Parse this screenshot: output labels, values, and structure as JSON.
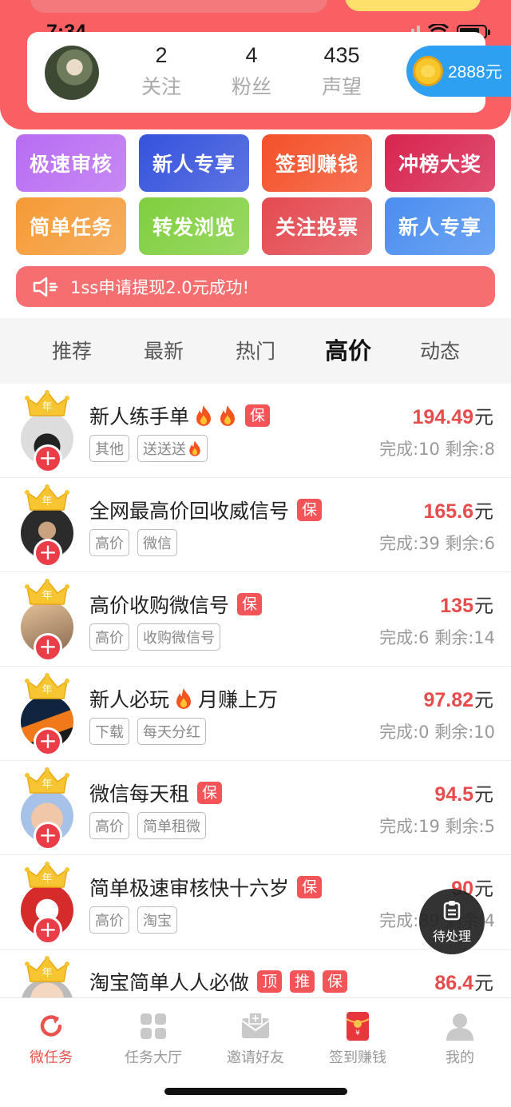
{
  "status_bar": {
    "time": "7:34"
  },
  "profile": {
    "stats": [
      {
        "value": "2",
        "label": "关注"
      },
      {
        "value": "4",
        "label": "粉丝"
      },
      {
        "value": "435",
        "label": "声望"
      }
    ],
    "coins": "2888元"
  },
  "grid_buttons": [
    {
      "label": "极速审核",
      "color": "#b86cf2"
    },
    {
      "label": "新人专享",
      "color": "#3552dc"
    },
    {
      "label": "签到赚钱",
      "color": "#f4502a"
    },
    {
      "label": "冲榜大奖",
      "color": "#d8244f"
    },
    {
      "label": "简单任务",
      "color": "#f59a36"
    },
    {
      "label": "转发浏览",
      "color": "#80cf3e"
    },
    {
      "label": "关注投票",
      "color": "#e44a50"
    },
    {
      "label": "新人专享",
      "color": "#4a8ef0"
    }
  ],
  "notice": {
    "text": "1ss申请提现2.0元成功!"
  },
  "tabs": [
    {
      "label": "推荐"
    },
    {
      "label": "最新"
    },
    {
      "label": "热门"
    },
    {
      "label": "高价",
      "active": true
    },
    {
      "label": "动态"
    }
  ],
  "crown_label": "年",
  "tasks": [
    {
      "title": "新人练手单",
      "fire": 2,
      "badges": [
        "保"
      ],
      "tags": [
        "其他",
        "送送送"
      ],
      "tag_fire": [
        false,
        true
      ],
      "price": "194.49",
      "unit": "元",
      "meta": "完成:10 剩余:8"
    },
    {
      "title": "全网最高价回收威信号",
      "fire": 0,
      "badges": [
        "保"
      ],
      "tags": [
        "高价",
        "微信"
      ],
      "tag_fire": [
        false,
        false
      ],
      "price": "165.6",
      "unit": "元",
      "meta": "完成:39 剩余:6"
    },
    {
      "title": "高价收购微信号",
      "fire": 0,
      "badges": [
        "保"
      ],
      "tags": [
        "高价",
        "收购微信号"
      ],
      "tag_fire": [
        false,
        false
      ],
      "price": "135",
      "unit": "元",
      "meta": "完成:6 剩余:14"
    },
    {
      "title": "新人必玩",
      "title2": "月赚上万",
      "fire": 1,
      "badges": [],
      "tags": [
        "下载",
        "每天分红"
      ],
      "tag_fire": [
        false,
        false
      ],
      "price": "97.82",
      "unit": "元",
      "meta": "完成:0 剩余:10"
    },
    {
      "title": "微信每天租",
      "fire": 0,
      "badges": [
        "保"
      ],
      "tags": [
        "高价",
        "简单租微"
      ],
      "tag_fire": [
        false,
        false
      ],
      "price": "94.5",
      "unit": "元",
      "meta": "完成:19 剩余:5"
    },
    {
      "title": "简单极速审核快十六岁",
      "fire": 0,
      "badges": [
        "保"
      ],
      "tags": [
        "高价",
        "淘宝"
      ],
      "tag_fire": [
        false,
        false
      ],
      "price": "90",
      "unit": "元",
      "meta": "完成:89 剩余:4"
    },
    {
      "title": "淘宝简单人人必做",
      "fire": 0,
      "badges": [
        "顶",
        "推",
        "保"
      ],
      "tags": [],
      "tag_fire": [],
      "price": "86.4",
      "unit": "元",
      "meta": ""
    }
  ],
  "fab": {
    "label": "待处理"
  },
  "bottom_nav": [
    {
      "label": "微任务",
      "icon": "refresh-icon",
      "active": true
    },
    {
      "label": "任务大厅",
      "icon": "grid-icon"
    },
    {
      "label": "邀请好友",
      "icon": "envelope-icon"
    },
    {
      "label": "签到赚钱",
      "icon": "red-packet-icon"
    },
    {
      "label": "我的",
      "icon": "person-icon"
    }
  ]
}
